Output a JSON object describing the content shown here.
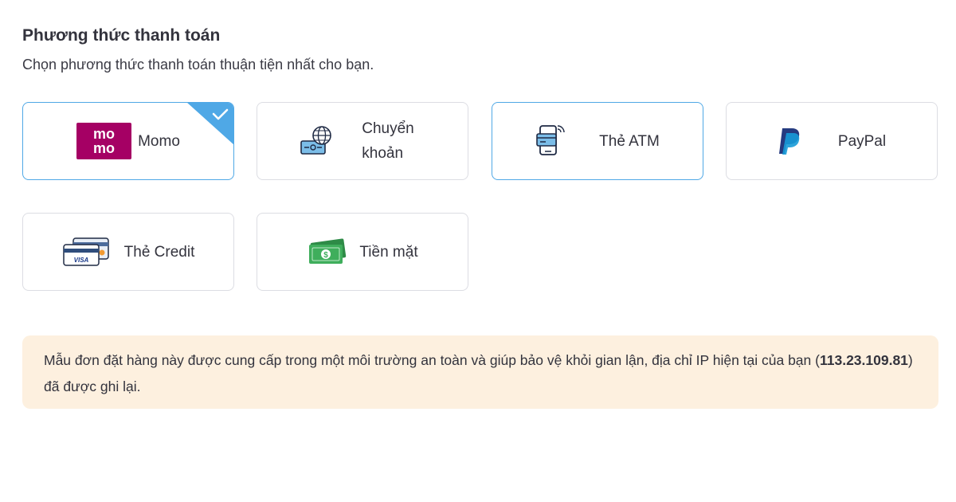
{
  "payment": {
    "title": "Phương thức thanh toán",
    "subtitle": "Chọn phương thức thanh toán thuận tiện nhất cho bạn.",
    "methods": [
      {
        "label": "Momo",
        "icon": "momo-logo",
        "selected": true
      },
      {
        "label_line1": "Chuyển",
        "label_line2": "khoản",
        "icon": "bank-transfer-icon",
        "selected": false
      },
      {
        "label": "Thẻ ATM",
        "icon": "atm-card-phone-icon",
        "selected": false
      },
      {
        "label": "PayPal",
        "icon": "paypal-logo",
        "selected": false
      },
      {
        "label": "Thẻ Credit",
        "icon": "credit-card-icon",
        "selected": false
      },
      {
        "label": "Tiền mặt",
        "icon": "cash-icon",
        "selected": false
      }
    ],
    "momo_logo_text": [
      "mo",
      "mo"
    ],
    "visa_text": "VISA"
  },
  "notice": {
    "text_before": "Mẫu đơn đặt hàng này được cung cấp trong một môi trường an toàn và giúp bảo vệ khỏi gian lận, địa chỉ IP hiện tại của bạn (",
    "ip": "113.23.109.81",
    "text_after": ") đã được ghi lại."
  },
  "colors": {
    "accent": "#4fa8e6",
    "momo": "#a50064",
    "paypal_dark": "#253b80",
    "paypal_light": "#179bd7",
    "notice_bg": "#fdf0df",
    "cash_green": "#3fae5c"
  }
}
